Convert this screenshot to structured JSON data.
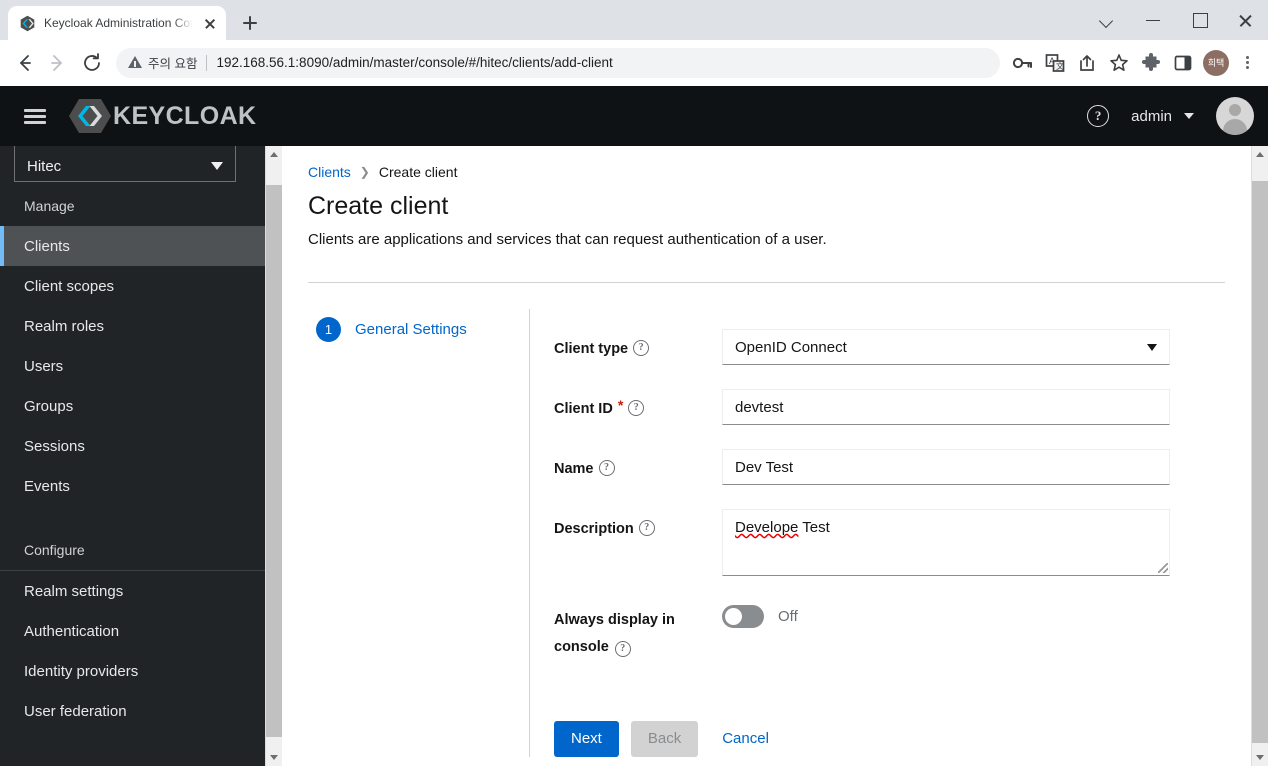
{
  "browser": {
    "tab": {
      "title": "Keycloak Administration Console",
      "favicon_icon": "keycloak-favicon",
      "close_icon": "close-icon"
    },
    "new_tab_icon": "plus-icon",
    "window_controls": {
      "chevron_icon": "chevron-down-icon",
      "minimize_icon": "minimize-icon",
      "maximize_icon": "maximize-icon",
      "close_icon": "close-icon"
    },
    "nav": {
      "back_icon": "arrow-left-icon",
      "forward_icon": "arrow-right-icon",
      "reload_icon": "reload-icon"
    },
    "omnibox": {
      "warning_icon": "warning-triangle-icon",
      "warning_text": "주의 요함",
      "url": "192.168.56.1:8090/admin/master/console/#/hitec/clients/add-client"
    },
    "toolbar_icons": [
      "key-icon",
      "translate-icon",
      "share-icon",
      "bookmark-star-icon",
      "extensions-puzzle-icon",
      "side-panel-icon"
    ],
    "profile": {
      "initials": "희택",
      "icon": "profile-avatar"
    },
    "menu_icon": "kebab-menu-icon"
  },
  "masthead": {
    "menu_icon": "hamburger-menu-icon",
    "logo_icon": "keycloak-logo-icon",
    "brand": "KEYCLOAK",
    "help_icon": "help-circle-icon",
    "user": "admin",
    "user_caret_icon": "chevron-down-icon",
    "avatar_icon": "user-avatar-icon"
  },
  "sidebar": {
    "realm": {
      "value": "Hitec",
      "caret_icon": "chevron-down-icon"
    },
    "sections": [
      {
        "title": "Manage",
        "items": [
          {
            "label": "Clients",
            "active": true
          },
          {
            "label": "Client scopes",
            "active": false
          },
          {
            "label": "Realm roles",
            "active": false
          },
          {
            "label": "Users",
            "active": false
          },
          {
            "label": "Groups",
            "active": false
          },
          {
            "label": "Sessions",
            "active": false
          },
          {
            "label": "Events",
            "active": false
          }
        ]
      },
      {
        "title": "Configure",
        "items": [
          {
            "label": "Realm settings",
            "active": false
          },
          {
            "label": "Authentication",
            "active": false
          },
          {
            "label": "Identity providers",
            "active": false
          },
          {
            "label": "User federation",
            "active": false
          }
        ]
      }
    ]
  },
  "breadcrumb": {
    "parent": "Clients",
    "separator_icon": "chevron-right-icon",
    "current": "Create client"
  },
  "page": {
    "title": "Create client",
    "subtitle": "Clients are applications and services that can request authentication of a user."
  },
  "wizard": {
    "steps": [
      {
        "number": "1",
        "label": "General Settings"
      }
    ]
  },
  "form": {
    "client_type": {
      "label": "Client type",
      "help_icon": "help-circle-icon",
      "value": "OpenID Connect",
      "caret_icon": "chevron-down-icon"
    },
    "client_id": {
      "label": "Client ID",
      "required_marker": "*",
      "help_icon": "help-circle-icon",
      "value": "devtest",
      "placeholder": ""
    },
    "name": {
      "label": "Name",
      "help_icon": "help-circle-icon",
      "value": "Dev Test",
      "placeholder": ""
    },
    "description": {
      "label": "Description",
      "help_icon": "help-circle-icon",
      "value_misspelled": "Develope",
      "value_rest": " Test",
      "placeholder": "",
      "resize_grip_icon": "resize-handle-icon"
    },
    "always_display": {
      "label_line1": "Always display in",
      "label_line2": "console",
      "help_icon": "help-circle-icon",
      "state": "Off"
    }
  },
  "actions": {
    "next": "Next",
    "back": "Back",
    "cancel": "Cancel"
  },
  "colors": {
    "primary_blue": "#0066cc",
    "link_blue": "#0066cc",
    "sidebar_bg": "#212427",
    "sidebar_active_bg": "#4f5255",
    "sidebar_accent": "#73bcf7",
    "masthead_bg": "#0f1214",
    "required_red": "#c9190b",
    "disabled_gray": "#d2d2d2"
  }
}
